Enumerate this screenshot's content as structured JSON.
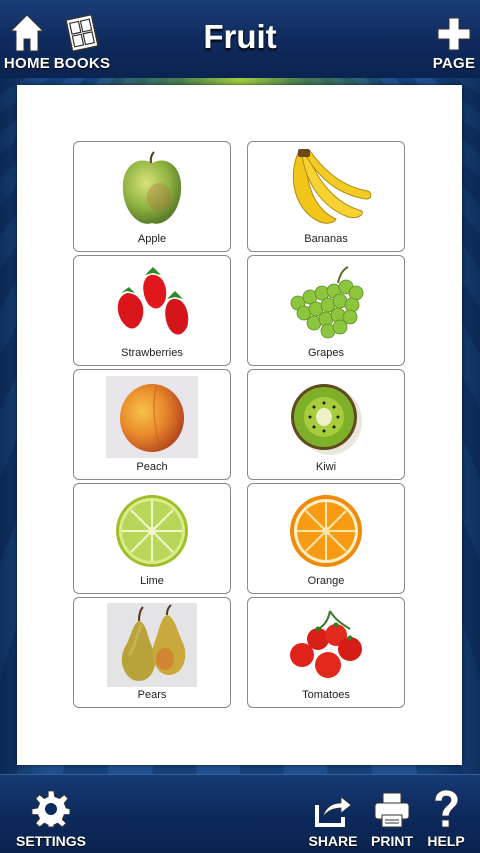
{
  "header": {
    "title": "Fruit",
    "home_label": "HOME",
    "books_label": "BOOKS",
    "page_label": "PAGE"
  },
  "cards": [
    {
      "label": "Apple",
      "icon": "apple-icon"
    },
    {
      "label": "Bananas",
      "icon": "bananas-icon"
    },
    {
      "label": "Strawberries",
      "icon": "strawberries-icon"
    },
    {
      "label": "Grapes",
      "icon": "grapes-icon"
    },
    {
      "label": "Peach",
      "icon": "peach-icon"
    },
    {
      "label": "Kiwi",
      "icon": "kiwi-icon"
    },
    {
      "label": "Lime",
      "icon": "lime-icon"
    },
    {
      "label": "Orange",
      "icon": "orange-icon"
    },
    {
      "label": "Pears",
      "icon": "pears-icon"
    },
    {
      "label": "Tomatoes",
      "icon": "tomatoes-icon"
    }
  ],
  "footer": {
    "settings_label": "SETTINGS",
    "share_label": "SHARE",
    "print_label": "PRINT",
    "help_label": "HELP"
  },
  "colors": {
    "bar": "#0e2a5c",
    "accent_green": "#a8cf3c"
  }
}
